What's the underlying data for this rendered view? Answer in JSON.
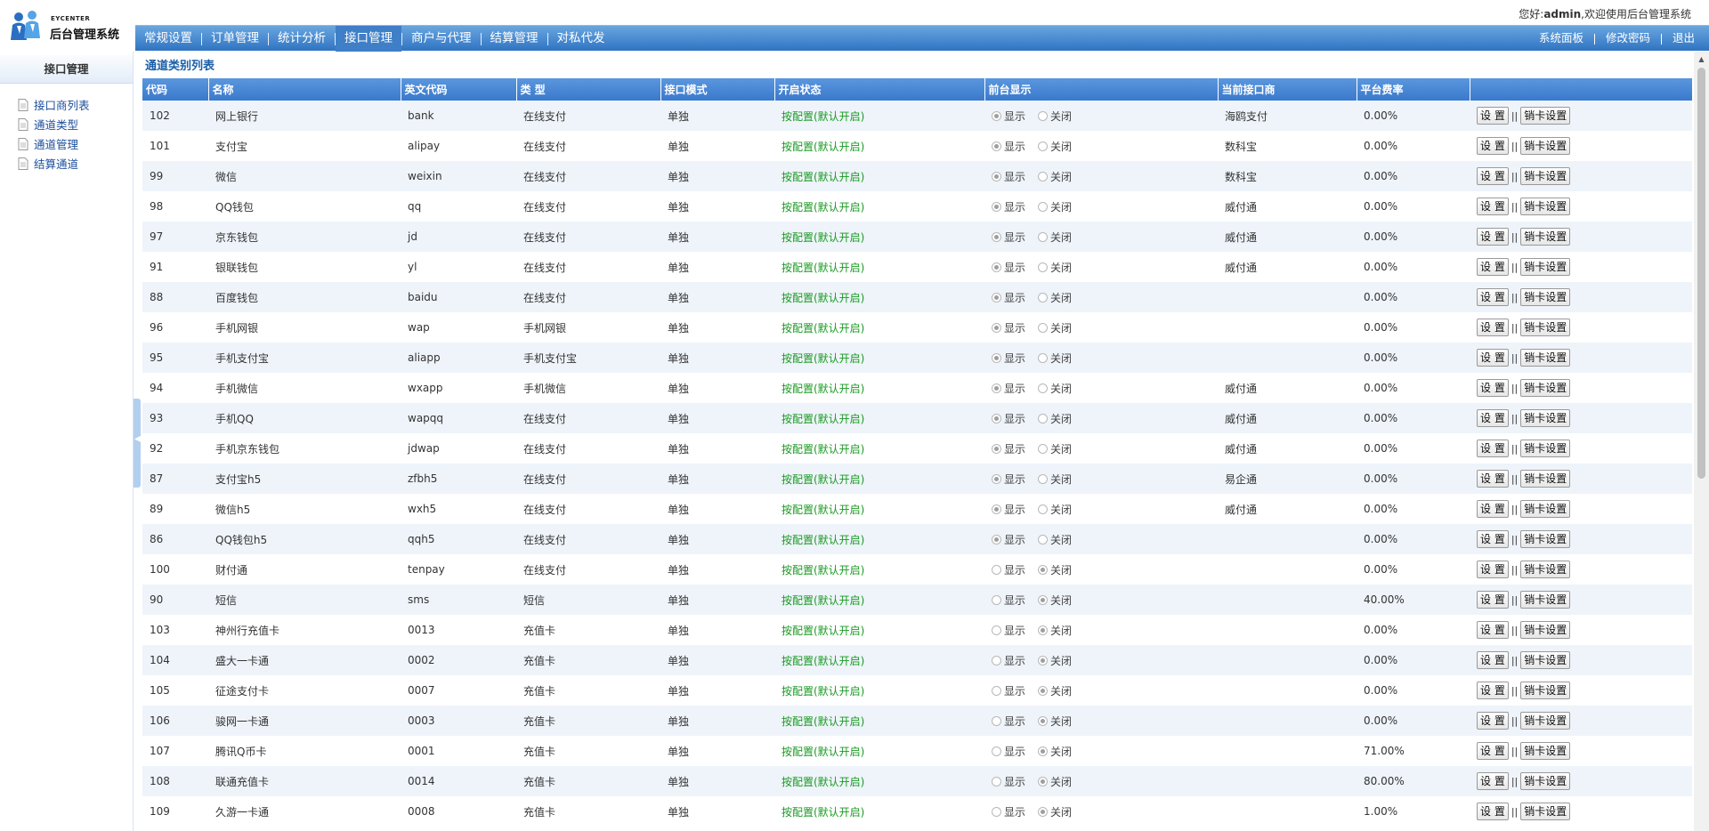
{
  "header": {
    "brand_small": "EYCENTER",
    "brand_title": "后台管理系统",
    "welcome_prefix": "您好:",
    "username": "admin",
    "welcome_suffix": ",欢迎使用后台管理系统"
  },
  "nav": {
    "items": [
      "常规设置",
      "订单管理",
      "统计分析",
      "接口管理",
      "商户与代理",
      "结算管理",
      "对私代发"
    ],
    "right_items": [
      "系统面板",
      "修改密码",
      "退出"
    ]
  },
  "sidebar": {
    "title": "接口管理",
    "items": [
      "接口商列表",
      "通道类型",
      "通道管理",
      "结算通道"
    ]
  },
  "page_title": "通道类别列表",
  "table": {
    "headers": [
      "代码",
      "名称",
      "英文代码",
      "类 型",
      "接口模式",
      "开启状态",
      "前台显示",
      "当前接口商",
      "平台费率",
      ""
    ],
    "show_label": "显示",
    "hide_label": "关闭",
    "btn_set": "设 置",
    "btn_card_set": "销卡设置",
    "btn_sep": "||",
    "rows": [
      {
        "code": "102",
        "name": "网上银行",
        "en": "bank",
        "type": "在线支付",
        "mode": "单独",
        "status": "按配置(默认开启)",
        "show": true,
        "provider": "海鸥支付",
        "rate": "0.00%"
      },
      {
        "code": "101",
        "name": "支付宝",
        "en": "alipay",
        "type": "在线支付",
        "mode": "单独",
        "status": "按配置(默认开启)",
        "show": true,
        "provider": "数科宝",
        "rate": "0.00%"
      },
      {
        "code": "99",
        "name": "微信",
        "en": "weixin",
        "type": "在线支付",
        "mode": "单独",
        "status": "按配置(默认开启)",
        "show": true,
        "provider": "数科宝",
        "rate": "0.00%"
      },
      {
        "code": "98",
        "name": "QQ钱包",
        "en": "qq",
        "type": "在线支付",
        "mode": "单独",
        "status": "按配置(默认开启)",
        "show": true,
        "provider": "威付通",
        "rate": "0.00%"
      },
      {
        "code": "97",
        "name": "京东钱包",
        "en": "jd",
        "type": "在线支付",
        "mode": "单独",
        "status": "按配置(默认开启)",
        "show": true,
        "provider": "威付通",
        "rate": "0.00%"
      },
      {
        "code": "91",
        "name": "银联钱包",
        "en": "yl",
        "type": "在线支付",
        "mode": "单独",
        "status": "按配置(默认开启)",
        "show": true,
        "provider": "威付通",
        "rate": "0.00%"
      },
      {
        "code": "88",
        "name": "百度钱包",
        "en": "baidu",
        "type": "在线支付",
        "mode": "单独",
        "status": "按配置(默认开启)",
        "show": true,
        "provider": "",
        "rate": "0.00%"
      },
      {
        "code": "96",
        "name": "手机网银",
        "en": "wap",
        "type": "手机网银",
        "mode": "单独",
        "status": "按配置(默认开启)",
        "show": true,
        "provider": "",
        "rate": "0.00%"
      },
      {
        "code": "95",
        "name": "手机支付宝",
        "en": "aliapp",
        "type": "手机支付宝",
        "mode": "单独",
        "status": "按配置(默认开启)",
        "show": true,
        "provider": "",
        "rate": "0.00%"
      },
      {
        "code": "94",
        "name": "手机微信",
        "en": "wxapp",
        "type": "手机微信",
        "mode": "单独",
        "status": "按配置(默认开启)",
        "show": true,
        "provider": "威付通",
        "rate": "0.00%"
      },
      {
        "code": "93",
        "name": "手机QQ",
        "en": "wapqq",
        "type": "在线支付",
        "mode": "单独",
        "status": "按配置(默认开启)",
        "show": true,
        "provider": "威付通",
        "rate": "0.00%"
      },
      {
        "code": "92",
        "name": "手机京东钱包",
        "en": "jdwap",
        "type": "在线支付",
        "mode": "单独",
        "status": "按配置(默认开启)",
        "show": true,
        "provider": "威付通",
        "rate": "0.00%"
      },
      {
        "code": "87",
        "name": "支付宝h5",
        "en": "zfbh5",
        "type": "在线支付",
        "mode": "单独",
        "status": "按配置(默认开启)",
        "show": true,
        "provider": "易企通",
        "rate": "0.00%"
      },
      {
        "code": "89",
        "name": "微信h5",
        "en": "wxh5",
        "type": "在线支付",
        "mode": "单独",
        "status": "按配置(默认开启)",
        "show": true,
        "provider": "威付通",
        "rate": "0.00%"
      },
      {
        "code": "86",
        "name": "QQ钱包h5",
        "en": "qqh5",
        "type": "在线支付",
        "mode": "单独",
        "status": "按配置(默认开启)",
        "show": true,
        "provider": "",
        "rate": "0.00%"
      },
      {
        "code": "100",
        "name": "财付通",
        "en": "tenpay",
        "type": "在线支付",
        "mode": "单独",
        "status": "按配置(默认开启)",
        "show": false,
        "provider": "",
        "rate": "0.00%"
      },
      {
        "code": "90",
        "name": "短信",
        "en": "sms",
        "type": "短信",
        "mode": "单独",
        "status": "按配置(默认开启)",
        "show": false,
        "provider": "",
        "rate": "40.00%"
      },
      {
        "code": "103",
        "name": "神州行充值卡",
        "en": "0013",
        "type": "充值卡",
        "mode": "单独",
        "status": "按配置(默认开启)",
        "show": false,
        "provider": "",
        "rate": "0.00%"
      },
      {
        "code": "104",
        "name": "盛大一卡通",
        "en": "0002",
        "type": "充值卡",
        "mode": "单独",
        "status": "按配置(默认开启)",
        "show": false,
        "provider": "",
        "rate": "0.00%"
      },
      {
        "code": "105",
        "name": "征途支付卡",
        "en": "0007",
        "type": "充值卡",
        "mode": "单独",
        "status": "按配置(默认开启)",
        "show": false,
        "provider": "",
        "rate": "0.00%"
      },
      {
        "code": "106",
        "name": "骏网一卡通",
        "en": "0003",
        "type": "充值卡",
        "mode": "单独",
        "status": "按配置(默认开启)",
        "show": false,
        "provider": "",
        "rate": "0.00%"
      },
      {
        "code": "107",
        "name": "腾讯Q币卡",
        "en": "0001",
        "type": "充值卡",
        "mode": "单独",
        "status": "按配置(默认开启)",
        "show": false,
        "provider": "",
        "rate": "71.00%"
      },
      {
        "code": "108",
        "name": "联通充值卡",
        "en": "0014",
        "type": "充值卡",
        "mode": "单独",
        "status": "按配置(默认开启)",
        "show": false,
        "provider": "",
        "rate": "80.00%"
      },
      {
        "code": "109",
        "name": "久游一卡通",
        "en": "0008",
        "type": "充值卡",
        "mode": "单独",
        "status": "按配置(默认开启)",
        "show": false,
        "provider": "",
        "rate": "1.00%"
      }
    ]
  },
  "colors": {
    "nav_blue": "#3a79cc",
    "status_green": "#1b9a23",
    "title_blue": "#1a5fa8"
  },
  "icons": {
    "logo": "people-logo-icon",
    "sidebar_item": "document-icon",
    "collapse": "collapse-arrow-icon"
  }
}
